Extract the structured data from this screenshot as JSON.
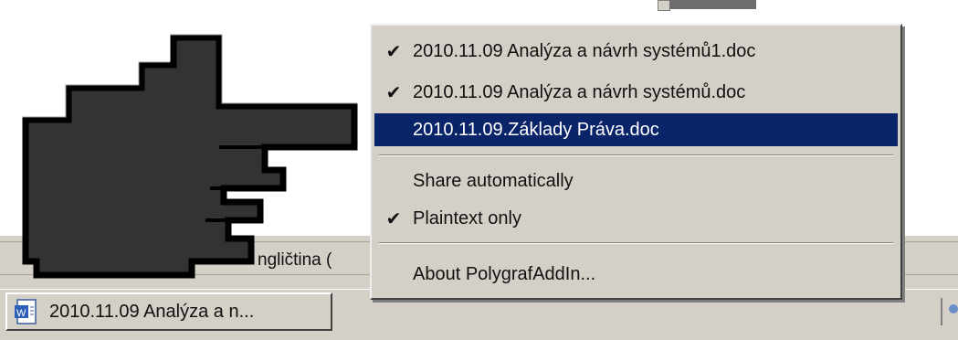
{
  "status_bar": {
    "language_text": "ngličtina ("
  },
  "taskbar": {
    "window_button_label": "2010.11.09 Analýza a n...",
    "icon": "word-document-icon"
  },
  "context_menu": {
    "items": [
      {
        "label": "2010.11.09 Analýza a návrh systémů1.doc",
        "checked": true
      },
      {
        "label": "2010.11.09 Analýza a návrh systémů.doc",
        "checked": true
      },
      {
        "label": "2010.11.09.Základy Práva.doc",
        "checked": false,
        "highlighted": true
      },
      {
        "label": "Share automatically",
        "checked": false
      },
      {
        "label": "Plaintext only",
        "checked": true
      },
      {
        "label": "About PolygrafAddIn...",
        "checked": false
      }
    ],
    "check_glyph": "✔"
  },
  "colors": {
    "menu_bg": "#d4d0c8",
    "highlight": "#0a246a",
    "cursor_fill": "#333333"
  }
}
